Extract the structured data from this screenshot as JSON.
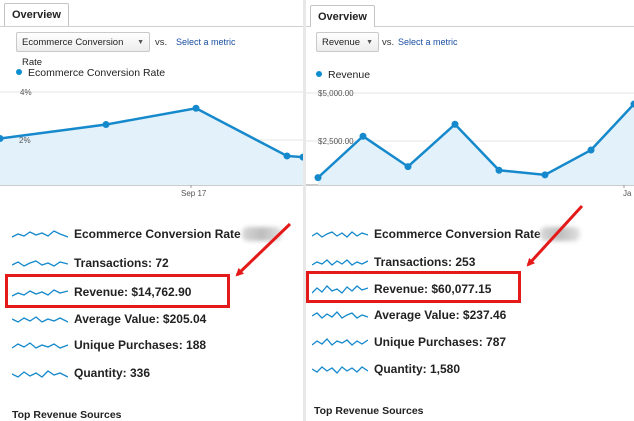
{
  "left": {
    "tab_label": "Overview",
    "metric_selector": "Ecommerce Conversion Rate",
    "vs_label": "vs.",
    "select_metric_link": "Select a metric",
    "legend_label": "Ecommerce Conversion Rate",
    "y_ticks": [
      "4%",
      "2%"
    ],
    "x_tick": "Sep 17",
    "chart_data": {
      "type": "area",
      "values": [
        2.0,
        2.6,
        3.3,
        1.25,
        1.2
      ],
      "ylim": [
        0,
        4
      ]
    },
    "metrics": [
      {
        "label": "Ecommerce Conversion Rate"
      },
      {
        "label": "Transactions: 72"
      },
      {
        "label": "Revenue: $14,762.90"
      },
      {
        "label": "Average Value: $205.04"
      },
      {
        "label": "Unique Purchases: 188"
      },
      {
        "label": "Quantity: 336"
      }
    ],
    "section_title": "Top Revenue Sources"
  },
  "right": {
    "tab_label": "Overview",
    "metric_selector": "Revenue",
    "vs_label": "vs.",
    "select_metric_link": "Select a metric",
    "legend_label": "Revenue",
    "y_ticks": [
      "$5,000.00",
      "$2,500.00"
    ],
    "x_tick": "Ja",
    "chart_data": {
      "type": "area",
      "values": [
        400,
        2650,
        1000,
        3300,
        800,
        550,
        1900,
        4400
      ],
      "ylim": [
        0,
        5000
      ]
    },
    "metrics": [
      {
        "label": "Ecommerce Conversion Rate"
      },
      {
        "label": "Transactions: 253"
      },
      {
        "label": "Revenue: $60,077.15"
      },
      {
        "label": "Average Value: $237.46"
      },
      {
        "label": "Unique Purchases: 787"
      },
      {
        "label": "Quantity: 1,580"
      }
    ],
    "section_title": "Top Revenue Sources"
  },
  "colors": {
    "line": "#1589cc",
    "fill": "#e3f1fa",
    "highlight": "#e41a1a"
  }
}
